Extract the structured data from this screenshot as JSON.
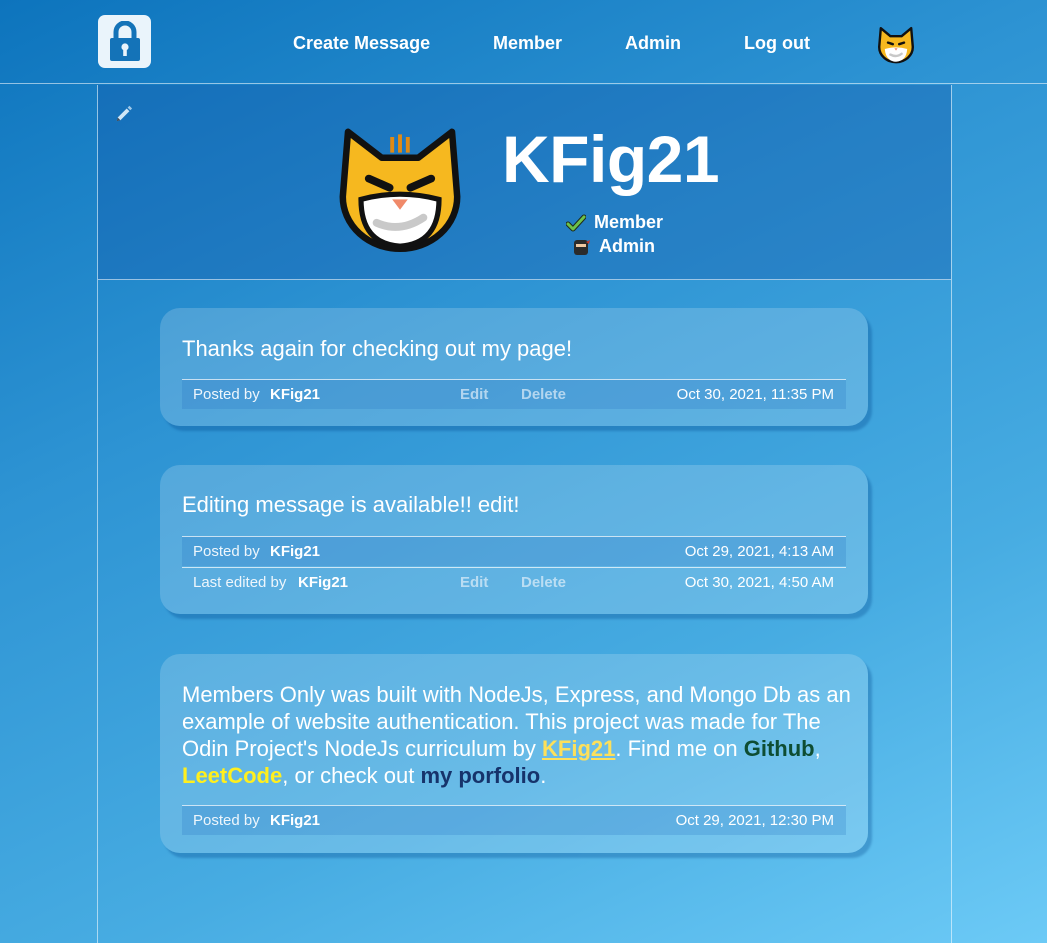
{
  "nav": {
    "links": [
      "Create Message",
      "Member",
      "Admin",
      "Log out"
    ],
    "logo_icon": "padlock-icon",
    "avatar_icon": "cat-face-icon"
  },
  "profile": {
    "username": "KFig21",
    "roles": [
      "Member",
      "Admin"
    ],
    "role_icons": [
      "checkmark-icon",
      "ninja-icon"
    ],
    "edit_icon": "pencil-icon"
  },
  "messages": [
    {
      "text": "Thanks again for checking out my page!",
      "posted_prefix": "Posted by",
      "posted_user": "KFig21",
      "edit_label": "Edit",
      "delete_label": "Delete",
      "posted_date": "Oct 30, 2021, 11:35 PM"
    },
    {
      "text": "Editing message is available!! edit!",
      "posted_prefix": "Posted by",
      "posted_user": "KFig21",
      "posted_date": "Oct 29, 2021, 4:13 AM",
      "edited_prefix": "Last edited by",
      "edited_user": "KFig21",
      "edit_label": "Edit",
      "delete_label": "Delete",
      "edited_date": "Oct 30, 2021, 4:50 AM"
    },
    {
      "text_1": "Members Only was built with NodeJs, Express, and Mongo Db as an example of website authentication. This project was made for The Odin Project's NodeJs curriculum by ",
      "link_author": "KFig21",
      "text_2": ". Find me on ",
      "link_github": "Github",
      "text_3": ", ",
      "link_leetcode": "LeetCode",
      "text_4": ", or check out ",
      "link_portfolio": "my porfolio",
      "text_5": ".",
      "posted_prefix": "Posted by",
      "posted_user": "KFig21",
      "posted_date": "Oct 29, 2021, 12:30 PM"
    }
  ],
  "colors": {
    "background_top": "#0d74bd",
    "background_bottom": "#6ccaf6",
    "link_author": "#fde05a",
    "link_github": "#0e4d33",
    "link_leetcode": "#ffef1e",
    "link_portfolio": "#16336b"
  }
}
